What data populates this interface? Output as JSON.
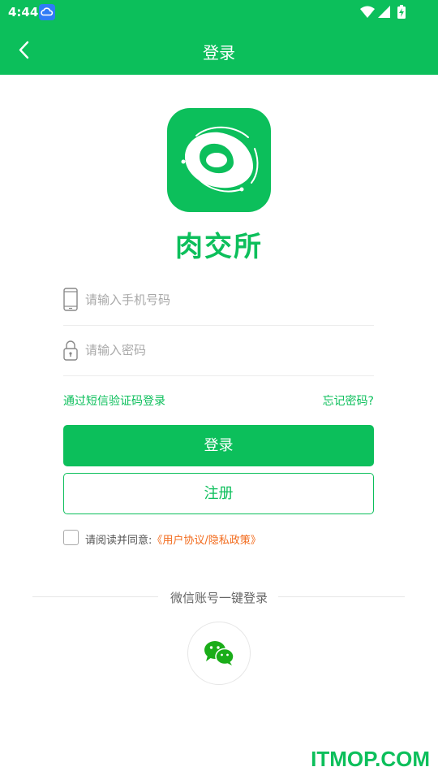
{
  "status_bar": {
    "time": "4:44",
    "cloud_icon": "cloud-icon",
    "right_icons": [
      "wifi-icon",
      "signal-icon",
      "battery-charging-icon"
    ]
  },
  "app_bar": {
    "back_icon": "chevron-left-icon",
    "title": "登录"
  },
  "logo": {
    "icon": "meat-logo-icon",
    "app_name": "肉交所"
  },
  "form": {
    "phone": {
      "icon": "phone-icon",
      "placeholder": "请输入手机号码",
      "value": ""
    },
    "password": {
      "icon": "lock-icon",
      "placeholder": "请输入密码",
      "value": ""
    },
    "sms_login_link": "通过短信验证码登录",
    "forgot_password_link": "忘记密码?",
    "login_button": "登录",
    "register_button": "注册",
    "agreement": {
      "checked": false,
      "prefix": "请阅读并同意:",
      "link": "《用户协议/隐私政策》"
    }
  },
  "social": {
    "divider_label": "微信账号一键登录",
    "wechat_icon": "wechat-icon"
  },
  "watermark": "ITMOP.COM",
  "colors": {
    "brand_green": "#0cbf5b",
    "link_orange": "#f26a1b"
  }
}
